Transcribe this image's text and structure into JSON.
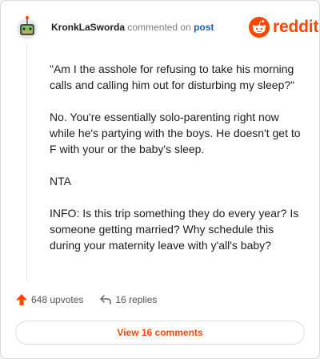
{
  "header": {
    "author": "KronkLaSworda",
    "commented_on": "commented on",
    "post_link": "post",
    "brand": "reddit"
  },
  "comment": {
    "paragraphs": [
      "\"Am I the asshole for refusing to take his morning calls and calling him out for disturbing my sleep?\"",
      "No. You're essentially solo-parenting right now while he's partying with the boys. He doesn't get to F with your or the baby's sleep.",
      "NTA",
      "INFO: Is this trip something they do every year? Is someone getting married? Why schedule this during your maternity leave with y'all's baby?"
    ]
  },
  "stats": {
    "upvotes": "648 upvotes",
    "replies": "16 replies"
  },
  "view_button": "View 16 comments",
  "colors": {
    "brand": "#ff4500",
    "link": "#1a5fb4",
    "text": "#1c1c1c"
  }
}
